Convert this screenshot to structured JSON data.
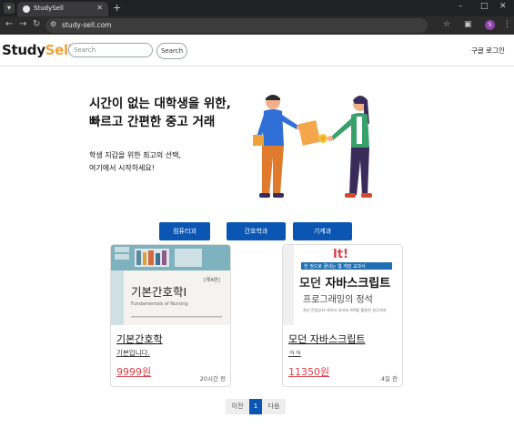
{
  "browser": {
    "tab_title": "StudySell",
    "url": "study-sell.com",
    "profile_initial": "S"
  },
  "nav": {
    "logo_main": "Study",
    "logo_accent": "Sell",
    "search_placeholder": "Search",
    "search_button": "Search",
    "login": "구글 로그인"
  },
  "hero": {
    "title_line1": "시간이 없는 대학생을 위한,",
    "title_line2": "빠르고 간편한 중고 거래",
    "sub_line1": "학생 지갑을 위한 최고의 선택,",
    "sub_line2": "여기에서 시작하세요!"
  },
  "categories": [
    {
      "label": "컴퓨터과"
    },
    {
      "label": "간호학과"
    },
    {
      "label": "기계과"
    }
  ],
  "products": [
    {
      "name": "기본간호학",
      "desc": "기본입니다.",
      "price": "9999원",
      "time": "20시간 전",
      "cover": {
        "edition": "[제4판]",
        "title": "기본간호학I",
        "subtitle": "Fundamentals of Nursing"
      }
    },
    {
      "name": "모던 자바스크립트",
      "desc": "ㅋㅋ",
      "price": "11350원",
      "time": "4일 전",
      "cover": {
        "badge": "It!",
        "banner": "한 권으로 끝내는 웹 개발 교과서",
        "title_a": "모던 ",
        "title_b": "자바스크립트",
        "subtitle": "프로그래밍의 정석",
        "blurb": "최신 문법부터 데이터 처리와 API를 활용한 실무까지"
      }
    }
  ],
  "pager": {
    "prev": "이전",
    "current": "1",
    "next": "다음"
  },
  "colors": {
    "primary": "#0b56b3",
    "accent": "#f0a23a",
    "price": "#d9404b"
  }
}
